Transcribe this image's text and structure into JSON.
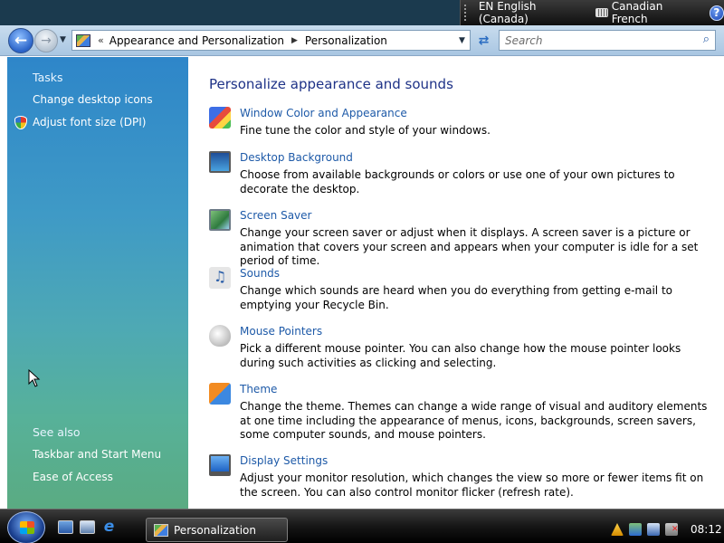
{
  "language_bar": {
    "input_language": "EN English (Canada)",
    "keyboard_layout": "Canadian French",
    "help_label": "?"
  },
  "toolbar": {
    "back_icon": "back-arrow-icon",
    "forward_icon": "forward-arrow-icon",
    "address": {
      "overflow_marker": "«",
      "crumbs": [
        "Appearance and Personalization",
        "Personalization"
      ],
      "separator": "▶"
    },
    "search_placeholder": "Search"
  },
  "sidebar": {
    "tasks_heading": "Tasks",
    "tasks": [
      "Change desktop icons",
      "Adjust font size (DPI)"
    ],
    "see_also_heading": "See also",
    "see_also": [
      "Taskbar and Start Menu",
      "Ease of Access"
    ]
  },
  "content": {
    "heading": "Personalize appearance and sounds",
    "items": [
      {
        "title": "Window Color and Appearance",
        "icon": "color-palette-icon",
        "description": "Fine tune the color and style of your windows."
      },
      {
        "title": "Desktop Background",
        "icon": "desktop-background-icon",
        "description": "Choose from available backgrounds or colors or use one of your own pictures to decorate the desktop."
      },
      {
        "title": "Screen Saver",
        "icon": "screen-saver-icon",
        "description": "Change your screen saver or adjust when it displays. A screen saver is a picture or animation that covers your screen and appears when your computer is idle for a set period of time."
      },
      {
        "title": "Sounds",
        "icon": "sounds-icon",
        "description": "Change which sounds are heard when you do everything from getting e-mail to emptying your Recycle Bin."
      },
      {
        "title": "Mouse Pointers",
        "icon": "mouse-icon",
        "description": "Pick a different mouse pointer. You can also change how the mouse pointer looks during such activities as clicking and selecting."
      },
      {
        "title": "Theme",
        "icon": "theme-icon",
        "description": "Change the theme. Themes can change a wide range of visual and auditory elements at one time including the appearance of menus, icons, backgrounds, screen savers, some computer sounds, and mouse pointers."
      },
      {
        "title": "Display Settings",
        "icon": "display-icon",
        "description": "Adjust your monitor resolution, which changes the view so more or fewer items fit on the screen. You can also control monitor flicker (refresh rate)."
      }
    ]
  },
  "taskbar": {
    "active_window": "Personalization",
    "clock": "08:12"
  }
}
